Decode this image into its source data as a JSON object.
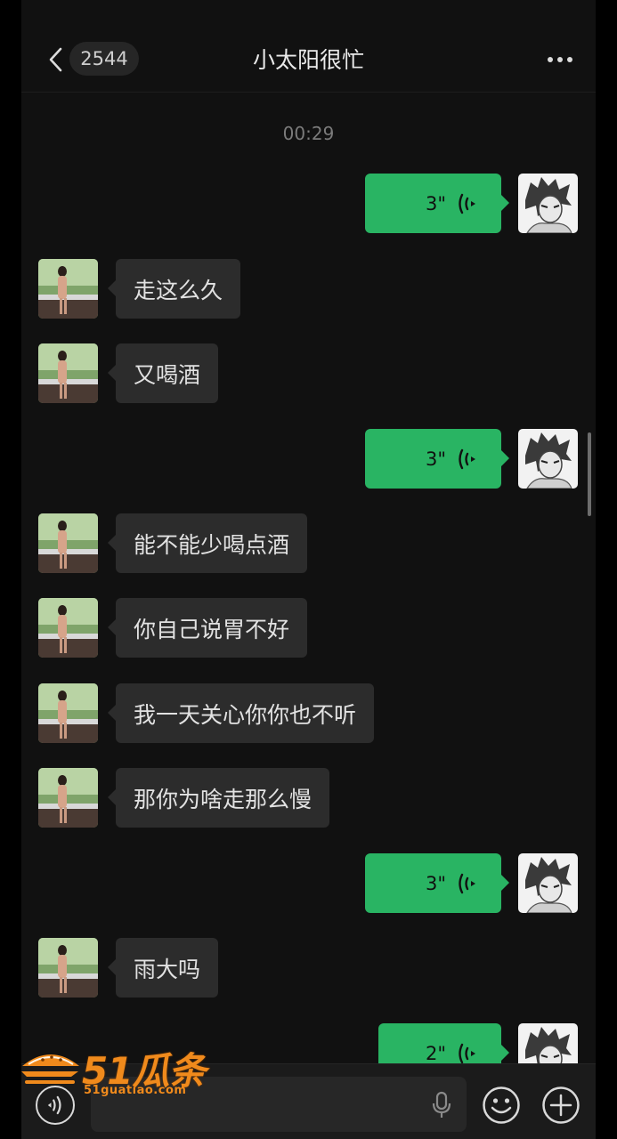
{
  "header": {
    "unread_count": "2544",
    "contact_name": "小太阳很忙"
  },
  "timestamp": "00:29",
  "messages": [
    {
      "side": "out",
      "type": "voice",
      "duration": "3\""
    },
    {
      "side": "in",
      "type": "text",
      "text": "走这么久"
    },
    {
      "side": "in",
      "type": "text",
      "text": "又喝酒"
    },
    {
      "side": "out",
      "type": "voice",
      "duration": "3\""
    },
    {
      "side": "in",
      "type": "text",
      "text": "能不能少喝点酒"
    },
    {
      "side": "in",
      "type": "text",
      "text": "你自己说胃不好"
    },
    {
      "side": "in",
      "type": "text",
      "text": "我一天关心你你也不听"
    },
    {
      "side": "in",
      "type": "text",
      "text": "那你为啥走那么慢"
    },
    {
      "side": "out",
      "type": "voice",
      "duration": "3\""
    },
    {
      "side": "in",
      "type": "text",
      "text": "雨大吗"
    },
    {
      "side": "out",
      "type": "voice",
      "duration": "2\""
    }
  ],
  "watermark": {
    "logo_text": "51瓜条",
    "url_text": "51guatiao.com"
  },
  "icons": {
    "back": "chevron-left-icon",
    "more": "more-dots-icon",
    "voice_mode": "voice-mode-icon",
    "mic": "microphone-icon",
    "emoji": "emoji-icon",
    "plus": "plus-icon"
  },
  "colors": {
    "outgoing_bubble": "#29b463",
    "incoming_bubble": "#2c2c2c",
    "background": "#111111",
    "watermark": "#f08a1c"
  }
}
